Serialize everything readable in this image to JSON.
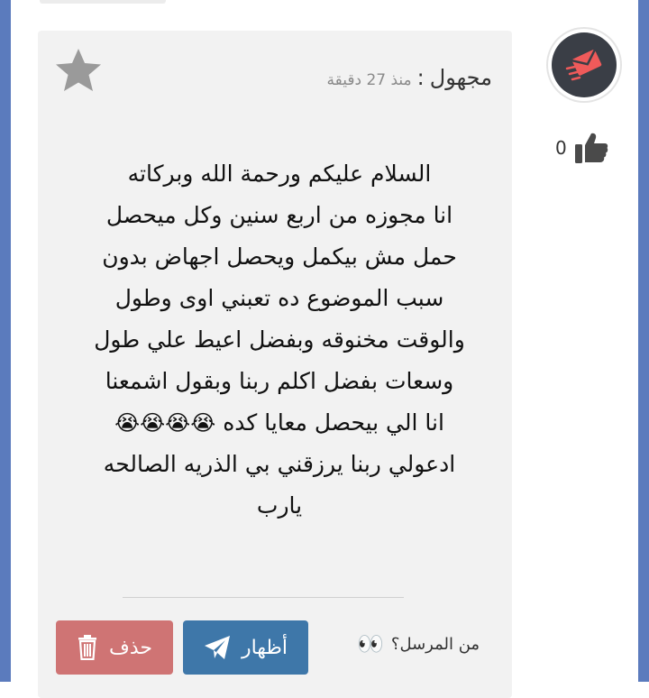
{
  "post": {
    "author": "مجهول",
    "separator": ":",
    "time_ago": "منذ 27 دقيقة",
    "message_lines": [
      "السلام عليكم ورحمة الله وبركاته",
      "انا مجوزه من اربع سنين وكل ميحصل",
      "حمل مش بيكمل ويحصل اجهاض بدون",
      "سبب الموضوع ده تعبني اوى وطول",
      "والوقت مخنوقه وبفضل اعيط علي طول",
      "وسعات بفضل اكلم ربنا وبقول اشمعنا",
      "انا الي بيحصل معايا كده",
      "ادعولي ربنا يرزقني بي الذريه الصالحه",
      "يارب"
    ],
    "crying_emojis": "😭😭😭😭"
  },
  "likes": {
    "count": "0"
  },
  "actions": {
    "show_label": "أظهار",
    "delete_label": "حذف",
    "sender_question": "من المرسل؟",
    "eyes_emoji": "👀"
  },
  "colors": {
    "frame": "#5b7bbd",
    "card_bg": "#f2f2f2",
    "show_button": "#3e77a9",
    "delete_button": "#cf7474",
    "avatar_bg": "#3a3e46",
    "avatar_icon": "#ef5a5a"
  },
  "icons": {
    "favorite": "star-icon",
    "avatar": "envelope-send-icon",
    "like": "thumbs-up-icon",
    "show": "paper-plane-icon",
    "delete": "trash-icon"
  }
}
